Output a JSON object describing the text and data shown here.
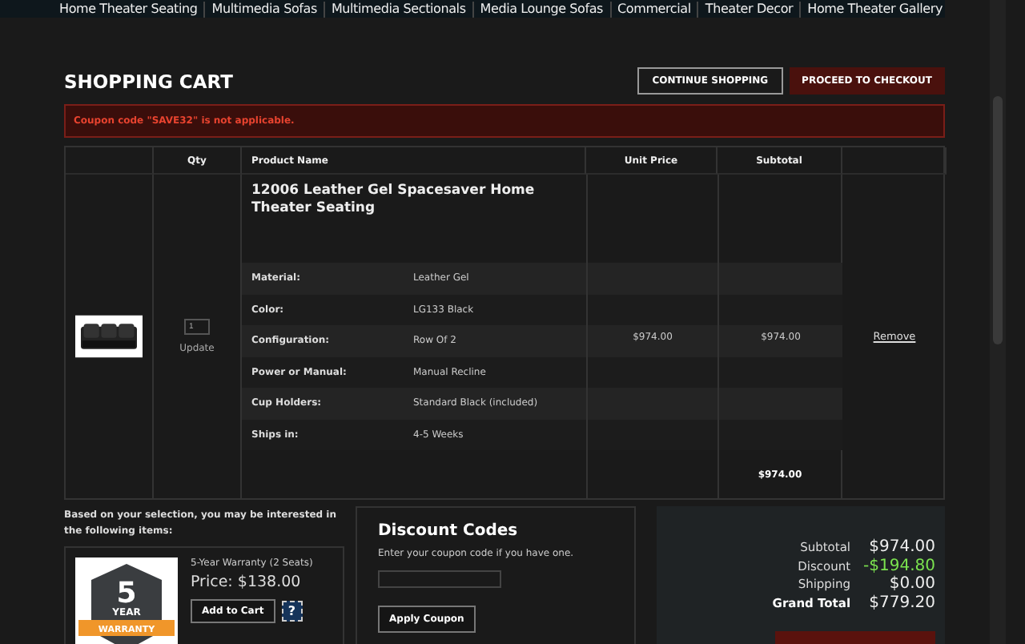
{
  "nav": {
    "items": [
      "Home Theater Seating",
      "Multimedia Sofas",
      "Multimedia Sectionals",
      "Media Lounge Sofas",
      "Commercial",
      "Theater Decor",
      "Home Theater Gallery"
    ]
  },
  "title": "SHOPPING CART",
  "buttons": {
    "continue": "CONTINUE SHOPPING",
    "checkout": "PROCEED TO CHECKOUT"
  },
  "message": "Coupon code \"SAVE32\" is not applicable.",
  "cart": {
    "columns": [
      "Qty",
      "Product Name",
      "Unit Price",
      "Subtotal"
    ],
    "items": [
      {
        "qty": "1",
        "update": "Update",
        "name": "12006 Leather Gel Spacesaver Home Theater Seating",
        "unit_price": "$974.00",
        "subtotal": "$974.00",
        "remove": "Remove",
        "options": [
          {
            "label": "Material:",
            "value": "Leather Gel"
          },
          {
            "label": "Color:",
            "value": "LG133 Black"
          },
          {
            "label": "Configuration:",
            "value": "Row Of 2"
          },
          {
            "label": "Power or Manual:",
            "value": "Manual Recline"
          },
          {
            "label": "Cup Holders:",
            "value": "Standard Black (included)"
          },
          {
            "label": "Ships in:",
            "value": "4-5 Weeks"
          }
        ]
      }
    ],
    "total": "$974.00"
  },
  "suggest": {
    "intro": "Based on your selection, you may be interested in the following items:",
    "product": {
      "badge": {
        "number": "5",
        "top": "YEAR",
        "ribbon": "WARRANTY"
      },
      "title": "5-Year Warranty (2 Seats)",
      "price": "Price: $138.00",
      "add": "Add to Cart",
      "help": "?"
    }
  },
  "discount": {
    "title": "Discount Codes",
    "hint": "Enter your coupon code if you have one.",
    "button": "Apply Coupon"
  },
  "totals": {
    "rows": [
      {
        "label": "Subtotal",
        "value": "$974.00",
        "kind": "plain"
      },
      {
        "label": "Discount",
        "value": "-$194.80",
        "kind": "discount"
      },
      {
        "label": "Shipping",
        "value": "$0.00",
        "kind": "plain"
      },
      {
        "label": "Grand Total",
        "value": "$779.20",
        "kind": "grand"
      }
    ]
  }
}
